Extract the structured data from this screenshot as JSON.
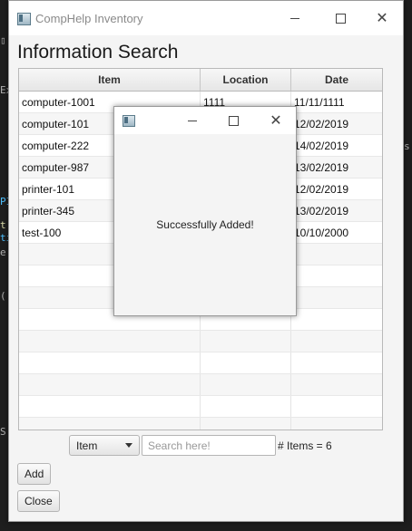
{
  "window": {
    "title": "CompHelp Inventory"
  },
  "page": {
    "heading": "Information Search"
  },
  "table": {
    "columns": [
      "Item",
      "Location",
      "Date"
    ],
    "rows": [
      [
        "computer-1001",
        "1111",
        "11/11/1111"
      ],
      [
        "computer-101",
        "",
        "12/02/2019"
      ],
      [
        "computer-222",
        "",
        "14/02/2019"
      ],
      [
        "computer-987",
        "",
        "13/02/2019"
      ],
      [
        "printer-101",
        "",
        "12/02/2019"
      ],
      [
        "printer-345",
        "",
        "13/02/2019"
      ],
      [
        "test-100",
        "",
        "10/10/2000"
      ],
      [
        "",
        "",
        ""
      ],
      [
        "",
        "",
        ""
      ],
      [
        "",
        "",
        ""
      ],
      [
        "",
        "",
        ""
      ],
      [
        "",
        "",
        ""
      ],
      [
        "",
        "",
        ""
      ],
      [
        "",
        "",
        ""
      ],
      [
        "",
        "",
        ""
      ],
      [
        "",
        "",
        ""
      ]
    ]
  },
  "search": {
    "filter_selected": "Item",
    "placeholder": "Search here!",
    "value": "",
    "count_label": "# Items = 6"
  },
  "buttons": {
    "add": "Add",
    "close": "Close"
  },
  "dialog": {
    "message": "Successfully Added!"
  },
  "icons": {
    "app": "app-window-icon",
    "minimize": "minimize-icon",
    "maximize": "maximize-icon",
    "close": "close-icon",
    "dropdown": "chevron-down-icon"
  }
}
